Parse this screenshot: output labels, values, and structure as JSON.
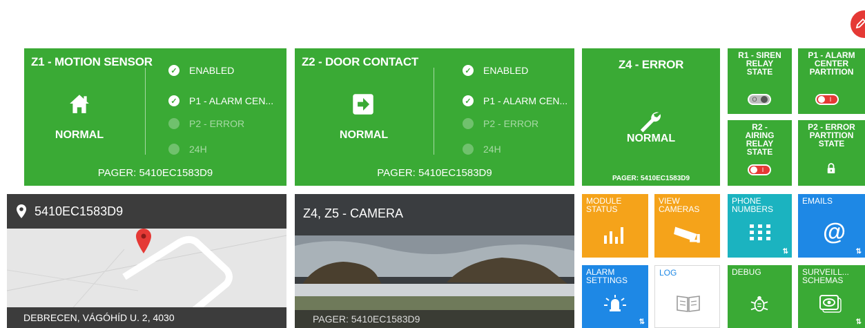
{
  "zones": [
    {
      "title": "Z1 - MOTION SENSOR",
      "icon": "home-icon",
      "status": "NORMAL",
      "pager": "PAGER: 5410EC1583D9",
      "features": [
        "ENABLED",
        "P1 - ALARM CEN...",
        "P2 - ERROR",
        "24H"
      ],
      "feature_states": [
        true,
        true,
        false,
        false
      ]
    },
    {
      "title": "Z2 - DOOR CONTACT",
      "icon": "door-enter-icon",
      "status": "NORMAL",
      "pager": "PAGER: 5410EC1583D9",
      "features": [
        "ENABLED",
        "P1 - ALARM CEN...",
        "P2 - ERROR",
        "24H"
      ],
      "feature_states": [
        true,
        true,
        false,
        false
      ]
    },
    {
      "title": "Z4 - ERROR",
      "icon": "wrench-icon",
      "status": "NORMAL",
      "pager": "PAGER: 5410EC1583D9"
    }
  ],
  "relays": [
    {
      "title": "R1 - SIREN RELAY STATE",
      "state": "off"
    },
    {
      "title": "P1 - ALARM CENTER PARTITION",
      "state": "on"
    },
    {
      "title": "R2 - AIRING RELAY STATE",
      "state": "on"
    },
    {
      "title": "P2 - ERROR PARTITION STATE",
      "state": "locked"
    }
  ],
  "map": {
    "device": "5410EC1583D9",
    "address": "DEBRECEN, VÁGÓHÍD U. 2, 4030"
  },
  "camera": {
    "title": "Z4, Z5 - CAMERA",
    "pager": "PAGER: 5410EC1583D9"
  },
  "modules": [
    {
      "label": "MODULE STATUS",
      "icon": "bar-chart-icon",
      "color": "#f5a31a"
    },
    {
      "label": "VIEW CAMERAS",
      "icon": "cctv-camera-icon",
      "color": "#f5a31a"
    },
    {
      "label": "PHONE NUMBERS",
      "icon": "keypad-icon",
      "color": "#1bb3c0"
    },
    {
      "label": "EMAILS",
      "icon": "at-icon",
      "color": "#1e88e5"
    },
    {
      "label": "ALARM SETTINGS",
      "icon": "alarm-bell-icon",
      "color": "#1e88e5"
    },
    {
      "label": "LOG",
      "icon": "book-icon",
      "color": "#ffffff"
    },
    {
      "label": "DEBUG",
      "icon": "bug-icon",
      "color": "#3aaa35"
    },
    {
      "label": "SURVEILL... SCHEMAS",
      "icon": "eye-icon",
      "color": "#3aaa35"
    }
  ],
  "colors": {
    "green": "#3aaa35",
    "orange": "#f5a31a",
    "teal": "#1bb3c0",
    "blue": "#1e88e5",
    "red": "#e53935"
  },
  "fab_icon": "edit-icon"
}
